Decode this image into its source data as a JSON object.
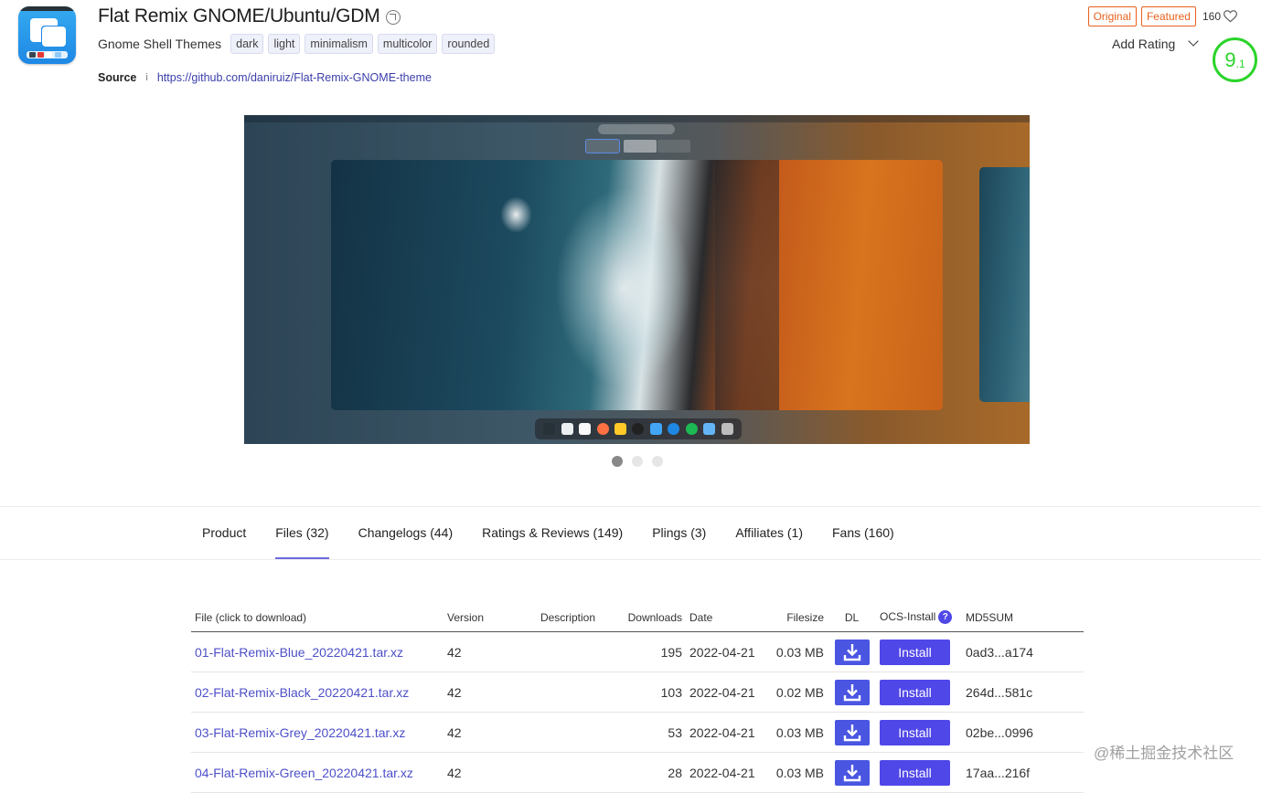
{
  "header": {
    "title": "Flat Remix GNOME/Ubuntu/GDM",
    "category": "Gnome Shell Themes",
    "tags": [
      "dark",
      "light",
      "minimalism",
      "multicolor",
      "rounded"
    ],
    "source_label": "Source",
    "source_info": "i",
    "source_url": "https://github.com/daniruiz/Flat-Remix-GNOME-theme",
    "badge_original": "Original",
    "badge_featured": "Featured",
    "likes": "160",
    "add_rating": "Add Rating",
    "score_major": "9",
    "score_minor": ".1"
  },
  "gallery": {
    "slides": 3,
    "active_slide": 0
  },
  "tabs": [
    {
      "label": "Product"
    },
    {
      "label": "Files (32)"
    },
    {
      "label": "Changelogs (44)"
    },
    {
      "label": "Ratings & Reviews (149)"
    },
    {
      "label": "Plings (3)"
    },
    {
      "label": "Affiliates (1)"
    },
    {
      "label": "Fans (160)"
    }
  ],
  "active_tab": "Files (32)",
  "files_table": {
    "headers": {
      "file": "File (click to download)",
      "version": "Version",
      "description": "Description",
      "downloads": "Downloads",
      "date": "Date",
      "filesize": "Filesize",
      "dl": "DL",
      "ocs": "OCS-Install",
      "ocs_help": "?",
      "md5": "MD5SUM"
    },
    "install_label": "Install",
    "rows": [
      {
        "file": "01-Flat-Remix-Blue_20220421.tar.xz",
        "version": "42",
        "description": "",
        "downloads": "195",
        "date": "2022-04-21",
        "filesize": "0.03 MB",
        "md5": "0ad3...a174"
      },
      {
        "file": "02-Flat-Remix-Black_20220421.tar.xz",
        "version": "42",
        "description": "",
        "downloads": "103",
        "date": "2022-04-21",
        "filesize": "0.02 MB",
        "md5": "264d...581c"
      },
      {
        "file": "03-Flat-Remix-Grey_20220421.tar.xz",
        "version": "42",
        "description": "",
        "downloads": "53",
        "date": "2022-04-21",
        "filesize": "0.03 MB",
        "md5": "02be...0996"
      },
      {
        "file": "04-Flat-Remix-Green_20220421.tar.xz",
        "version": "42",
        "description": "",
        "downloads": "28",
        "date": "2022-04-21",
        "filesize": "0.03 MB",
        "md5": "17aa...216f"
      }
    ]
  },
  "watermark": "@稀土掘金技术社区",
  "colors": {
    "accent": "#5047e8",
    "link": "#4d50c8",
    "badge": "#e8611e",
    "score": "#2bd42b"
  },
  "icons": [
    "app-icon",
    "external-link-icon",
    "heart-icon",
    "chevron-down-icon",
    "download-icon",
    "help-icon"
  ]
}
